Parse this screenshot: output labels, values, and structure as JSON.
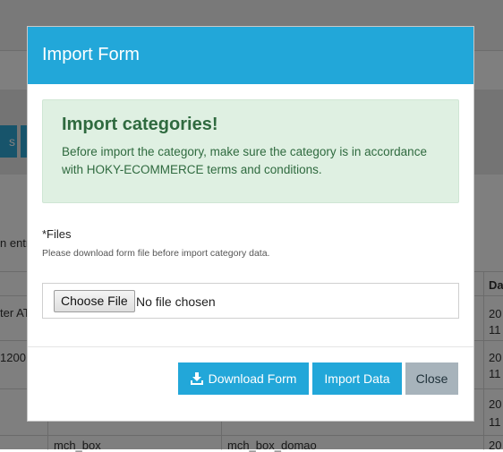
{
  "background": {
    "partial_button_text": "s",
    "entries_text": "n entri",
    "table": {
      "header_right": "Da",
      "rows": [
        {
          "col1": "ter AT",
          "col_right_1": "20",
          "col_right_2": "11"
        },
        {
          "col1": "1200",
          "col_right_1": "20",
          "col_right_2": "11"
        },
        {
          "col1": "",
          "col_right_1": "20",
          "col_right_2": "11"
        },
        {
          "col1": "mch_box",
          "col2": "mch_box_domao",
          "col_right_1": "20"
        }
      ]
    }
  },
  "modal": {
    "title": "Import Form",
    "alert": {
      "title": "Import categories!",
      "text": "Before import the category, make sure the category is in accordance with HOKY-ECOMMERCE terms and conditions."
    },
    "files": {
      "label": "*Files",
      "help": "Please download form file before import category data.",
      "choose_button": "Choose File",
      "no_file_text": "No file chosen"
    },
    "buttons": {
      "download": "Download Form",
      "import": "Import Data",
      "close": "Close"
    },
    "icons": {
      "download": "download-icon"
    },
    "colors": {
      "header": "#22a7d9",
      "primary_button": "#22a7d9",
      "close_button": "#a7b3bb",
      "alert_background": "#dff0e2",
      "alert_text": "#2f6a3f"
    }
  }
}
